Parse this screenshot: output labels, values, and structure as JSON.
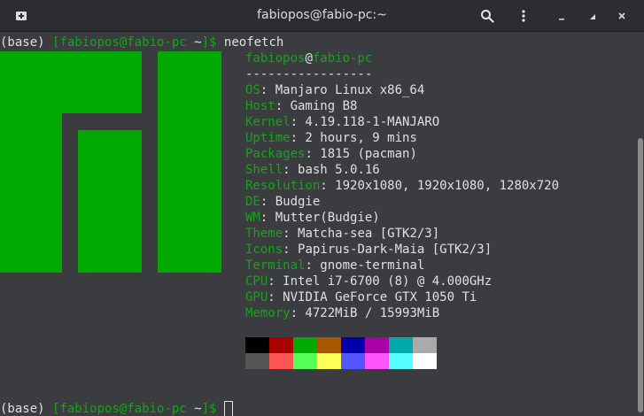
{
  "window": {
    "title": "fabiopos@fabio-pc:~"
  },
  "icons": {
    "new_tab": "new-tab-icon",
    "search": "search-icon",
    "menu": "kebab-menu-icon",
    "minimize": "minimize-icon",
    "maximize": "maximize-icon",
    "close": "close-icon"
  },
  "colors": {
    "accent_green": "#17a31a",
    "logo_green": "#00a800",
    "background": "#3b3c40",
    "text": "#e0e0e0"
  },
  "prompt1": {
    "env": "(base) ",
    "user": "[fabiopos@fabio-pc ",
    "dir": "~",
    "close": "]$ ",
    "command": "neofetch"
  },
  "neofetch": {
    "user": "fabiopos",
    "at": "@",
    "host": "fabio-pc",
    "separator": "-----------------",
    "info": [
      {
        "key": "OS",
        "value": ": Manjaro Linux x86_64"
      },
      {
        "key": "Host",
        "value": ": Gaming B8"
      },
      {
        "key": "Kernel",
        "value": ": 4.19.118-1-MANJARO"
      },
      {
        "key": "Uptime",
        "value": ": 2 hours, 9 mins"
      },
      {
        "key": "Packages",
        "value": ": 1815 (pacman)"
      },
      {
        "key": "Shell",
        "value": ": bash 5.0.16"
      },
      {
        "key": "Resolution",
        "value": ": 1920x1080, 1920x1080, 1280x720"
      },
      {
        "key": "DE",
        "value": ": Budgie"
      },
      {
        "key": "WM",
        "value": ": Mutter(Budgie)"
      },
      {
        "key": "Theme",
        "value": ": Matcha-sea [GTK2/3]"
      },
      {
        "key": "Icons",
        "value": ": Papirus-Dark-Maia [GTK2/3]"
      },
      {
        "key": "Terminal",
        "value": ": gnome-terminal"
      },
      {
        "key": "CPU",
        "value": ": Intel i7-6700 (8) @ 4.000GHz"
      },
      {
        "key": "GPU",
        "value": ": NVIDIA GeForce GTX 1050 Ti"
      },
      {
        "key": "Memory",
        "value": ": 4722MiB / 15993MiB"
      }
    ],
    "palette_row1": [
      "#000000",
      "#aa0000",
      "#00aa00",
      "#aa5500",
      "#0000aa",
      "#aa00aa",
      "#00aaaa",
      "#aaaaaa"
    ],
    "palette_row2": [
      "#555555",
      "#ff5555",
      "#55ff55",
      "#ffff55",
      "#5555ff",
      "#ff55ff",
      "#55ffff",
      "#ffffff"
    ]
  },
  "prompt2": {
    "env": "(base) ",
    "user": "[fabiopos@fabio-pc ",
    "dir": "~",
    "close": "]$ "
  }
}
